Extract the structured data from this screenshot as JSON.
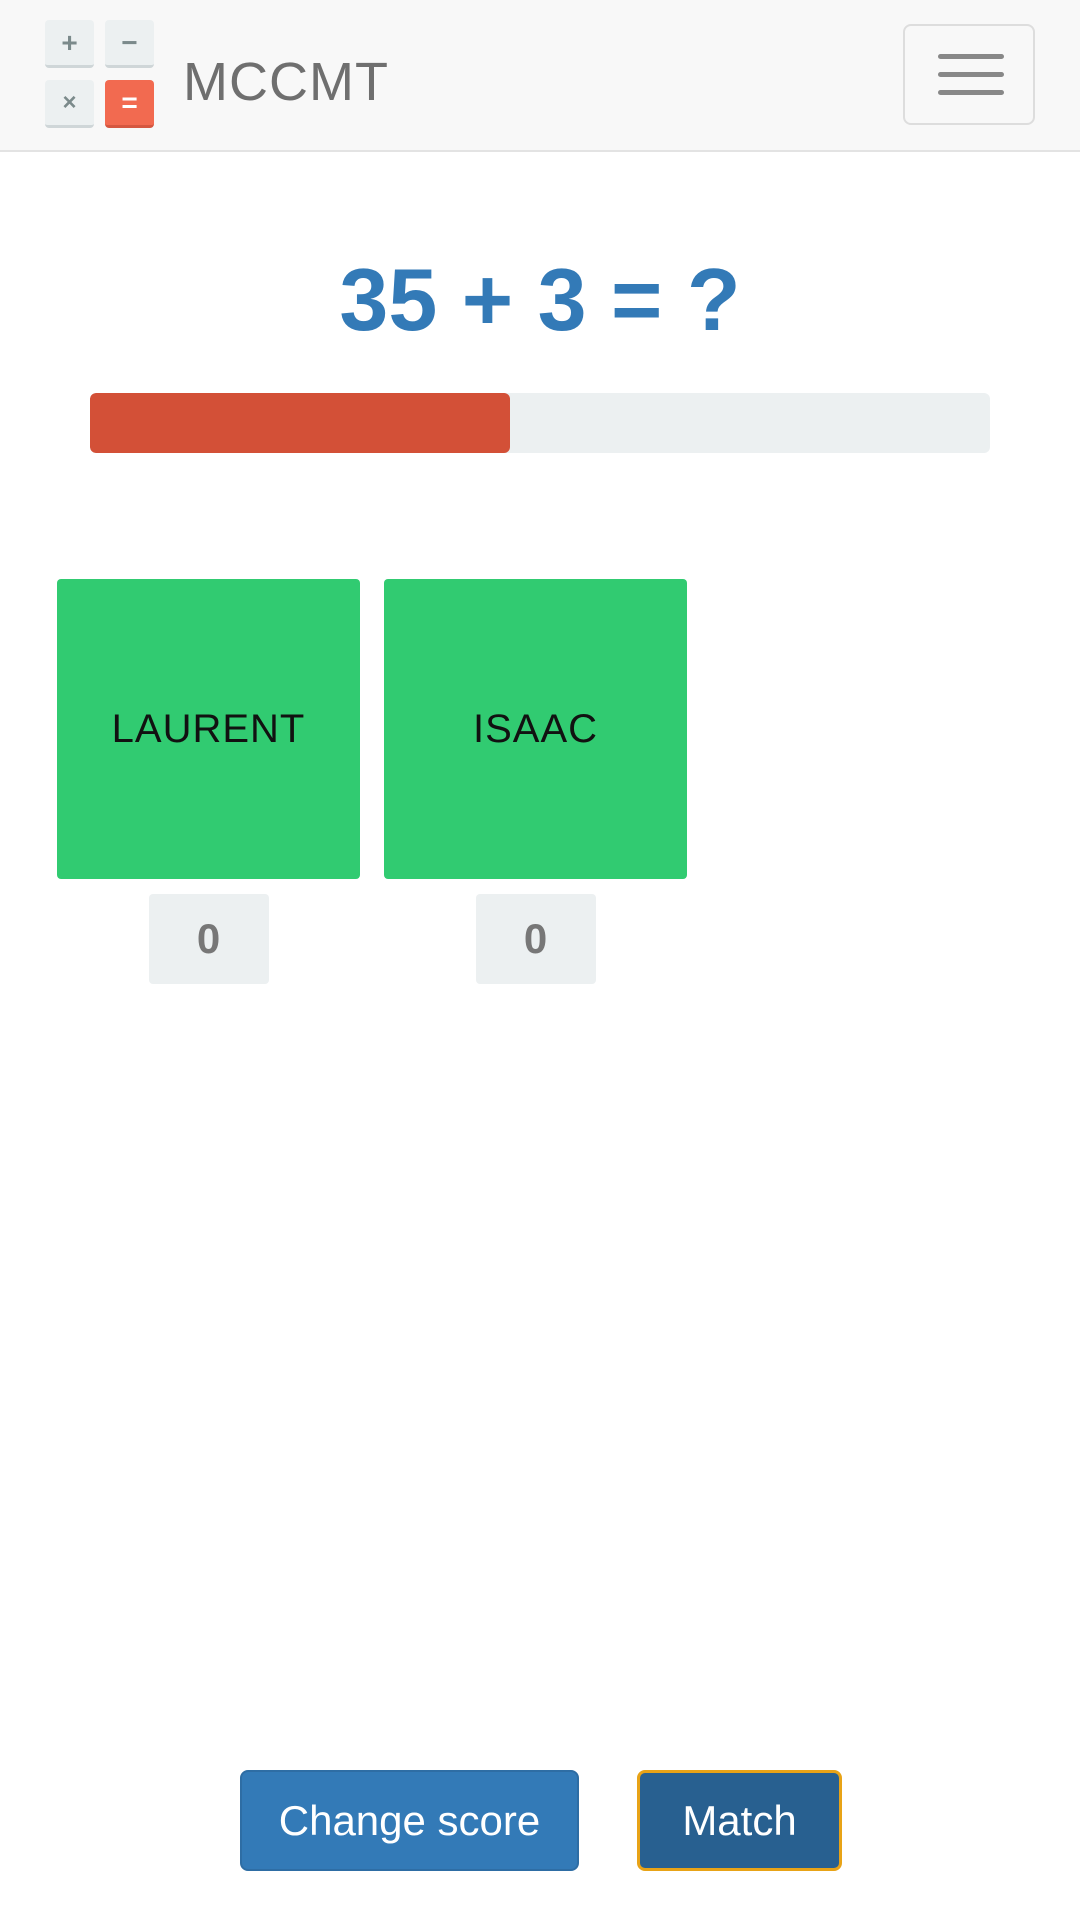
{
  "navbar": {
    "logo_keys": [
      "+",
      "−",
      "×",
      "="
    ],
    "brand": "MCCMT",
    "menu_icon": "hamburger-icon"
  },
  "question": {
    "text": "35 + 3 = ?"
  },
  "timer": {
    "progress_percent": 46.7
  },
  "players": [
    {
      "name": "LAURENT",
      "score": "0"
    },
    {
      "name": "ISAAC",
      "score": "0"
    }
  ],
  "actions": {
    "change_score_label": "Change score",
    "match_label": "Match"
  },
  "colors": {
    "accent_blue": "#337ab7",
    "progress_red": "#d35037",
    "player_green": "#31cb71",
    "logo_equals": "#f26a50",
    "focus_outline": "#e8a317"
  }
}
